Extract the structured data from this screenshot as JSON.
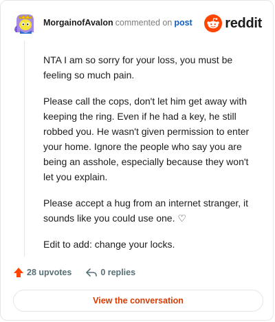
{
  "header": {
    "username": "MorgainofAvalon",
    "action_text": "commented on",
    "post_link": "post",
    "brand_word": "reddit",
    "brand_color": "#ff4500",
    "avatar_icon": "snoo-avatar"
  },
  "comment": {
    "paragraphs": [
      "NTA I am so sorry for your loss, you must be feeling so much pain.",
      "Please call the cops, don't let him get away with keeping the ring. Even if he had a key, he still robbed you. He wasn't given permission to enter your home. Ignore the people who say you are being an asshole, especially because they won't let you explain.",
      "Please accept a hug from an internet stranger, it sounds like you could use one. ♡",
      "Edit to add: change your locks."
    ]
  },
  "footer": {
    "upvotes_label": "28 upvotes",
    "replies_label": "0 replies",
    "upvote_color": "#ff4500",
    "upvote_icon": "upvote-arrow-icon",
    "reply_icon": "reply-arrow-icon"
  },
  "cta": {
    "label": "View the conversation",
    "color": "#d93a00"
  }
}
